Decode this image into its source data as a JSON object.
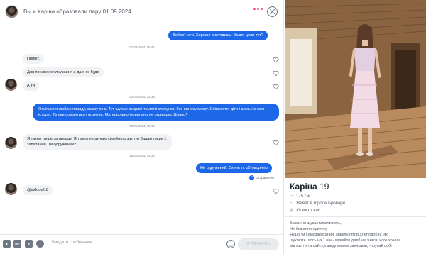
{
  "header": {
    "title": "Вы и Каріна образовали пару 01.09.2024."
  },
  "messages": [
    {
      "text": "Доброї ночі. Хорошо виглядишь. Какие цели тут?"
    },
    {
      "text": "Привіт."
    },
    {
      "text": "Для початку спілкування а далі як буде"
    },
    {
      "text": "А ти"
    },
    {
      "text": "Оскільки я люблю правду, скажу як є. Тут шукаю всиряві та легкі стосунки, без виносу мозку. Співжиття, діти і щось не моя історія. Тільки романтика і позитив. Матеріально-морально не скривджу. Цікаво?"
    },
    {
      "text": "Я також лише за правду. Я також не шукаю сімейного життя) Задам лише 1 запитання. Ти одружений?"
    },
    {
      "text": "Не одружений. Скинь тг. обговоримо"
    },
    {
      "text": "@asfodel18"
    }
  ],
  "timestamps": [
    "01.09.2024, 05:45",
    "02.09.2024, 22:38",
    "03.09.2024, 09:18",
    "15.09.2024, 14:24"
  ],
  "status": {
    "seen": "Отправлено"
  },
  "footer": {
    "gif_label": "GIF",
    "placeholder": "Введите сообщение",
    "send_label": "ОТПРАВИТЬ"
  },
  "profile": {
    "name": "Каріна",
    "age": "19",
    "height": "175 см",
    "location": "Живёт в городе Бровари",
    "distance": "39 км от вас",
    "bio": [
      "Бажання шукає можливість,",
      "Не бажання причину",
      "Якщо ти самозакоханий, маніпулятор,хлеподобіні, які",
      "шукають щось на 1 ніч - шукайте далі! не знаєш чого хочеш",
      "від життя та сайту,з шкідливими звичками, - шукай собі"
    ]
  },
  "colors": {
    "accent": "#1c68e8",
    "brand": "#fd3a5c"
  },
  "icons": [
    "smile-icon",
    "close-icon",
    "more-icon",
    "heart-icon",
    "ruler-icon",
    "home-icon",
    "pin-icon",
    "verified-icon"
  ]
}
